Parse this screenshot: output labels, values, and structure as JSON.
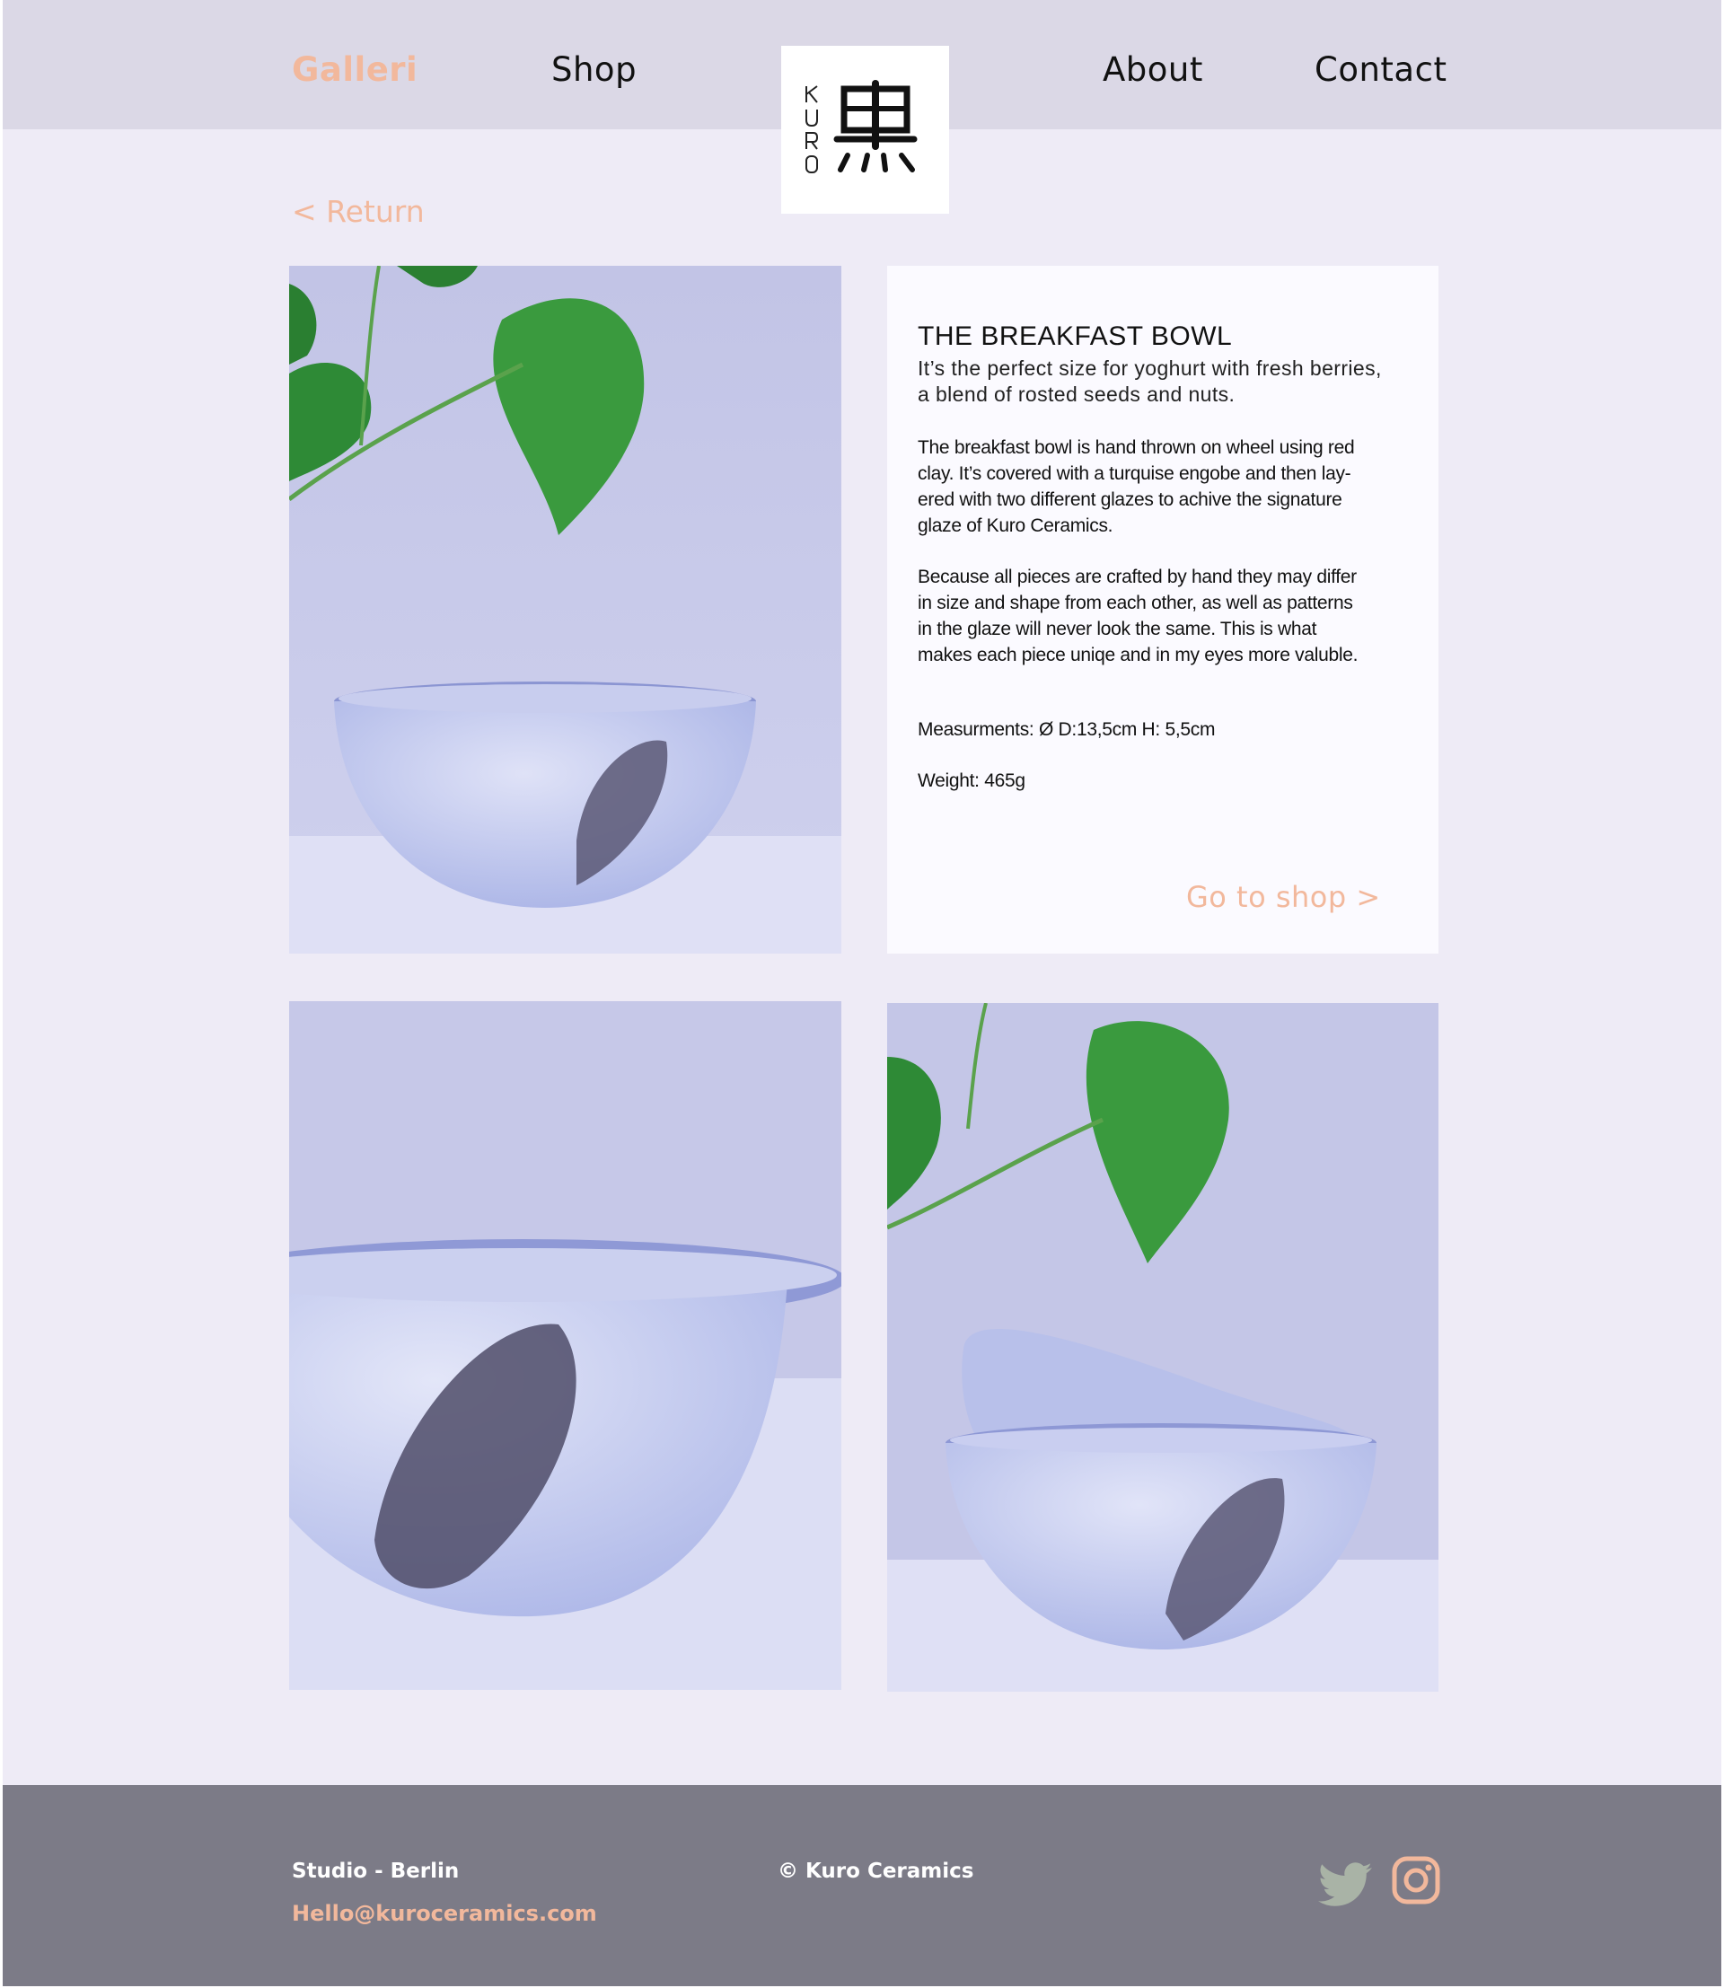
{
  "nav": {
    "items": [
      {
        "label": "Galleri",
        "active": true
      },
      {
        "label": "Shop",
        "active": false
      },
      {
        "label": "About",
        "active": false
      },
      {
        "label": "Contact",
        "active": false
      }
    ],
    "logo": {
      "latin": "KURO",
      "kanji": "黒"
    }
  },
  "return_label": "< Return",
  "product": {
    "title": "THE BREAKFAST BOWL",
    "subtitle_lines": [
      "It’s the perfect size for yoghurt with fresh berries,",
      "a blend of rosted seeds and nuts."
    ],
    "description_1_lines": [
      "The breakfast bowl is hand thrown on wheel using red",
      "clay. It’s covered with a turquise engobe and then lay-",
      "ered with two different glazes to achive the signature",
      "glaze of Kuro Ceramics."
    ],
    "description_2_lines": [
      "Because all pieces are crafted by hand they may differ",
      "in size and shape from each other, as well as patterns",
      "in the glaze will never look the same. This is what",
      "makes each piece uniqe and in my eyes more valuble."
    ],
    "measurements": "Measurments: Ø D:13,5cm  H: 5,5cm",
    "weight": "Weight: 465g",
    "shop_link": "Go to shop >"
  },
  "footer": {
    "studio": "Studio - Berlin",
    "email": "Hello@kuroceramics.com",
    "copyright": "© Kuro Ceramics",
    "social": [
      "twitter-icon",
      "instagram-icon"
    ]
  },
  "colors": {
    "accent": "#f2b89c",
    "header_bg": "#dbd8e6",
    "page_bg": "#eeebf6",
    "footer_bg": "#7c7b87",
    "twitter": "#a9b3a6"
  }
}
